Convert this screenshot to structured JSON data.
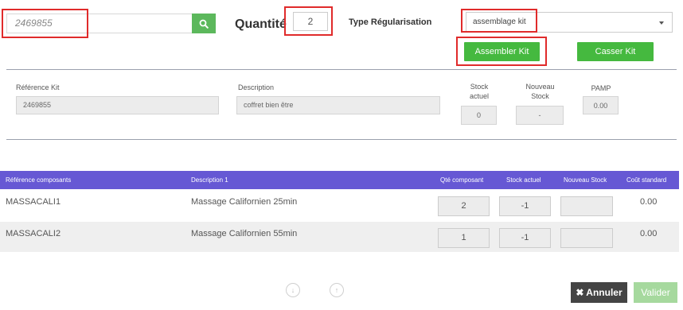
{
  "search": {
    "value": "2469855"
  },
  "quantity": {
    "label": "Quantité",
    "value": "2"
  },
  "regularisation": {
    "label": "Type Régularisation",
    "value": "assemblage kit"
  },
  "buttons": {
    "assembler": "Assembler Kit",
    "casser": "Casser Kit",
    "annuler": "Annuler",
    "valider": "Valider"
  },
  "kit": {
    "ref_label": "Référence Kit",
    "ref_value": "2469855",
    "desc_label": "Description",
    "desc_value": "coffret bien être",
    "stock_actuel_label": [
      "Stock",
      "actuel"
    ],
    "stock_actuel_value": "0",
    "nouveau_stock_label": [
      "Nouveau",
      "Stock"
    ],
    "nouveau_stock_value": "-",
    "pamp_label": "PAMP",
    "pamp_value": "0.00"
  },
  "table": {
    "headers": {
      "ref": "Référence composants",
      "desc": "Description 1",
      "qte": "Qté composant",
      "stock": "Stock actuel",
      "nouveau": "Nouveau Stock",
      "cout": "Coût standard"
    },
    "rows": [
      {
        "ref": "MASSACALI1",
        "desc": "Massage Californien 25min",
        "qte": "2",
        "stock": "-1",
        "nouveau": "",
        "cout": "0.00"
      },
      {
        "ref": "MASSACALI2",
        "desc": "Massage Californien 55min",
        "qte": "1",
        "stock": "-1",
        "nouveau": "",
        "cout": "0.00"
      }
    ]
  },
  "colors": {
    "green": "#45b93f",
    "purple": "#6658d4",
    "highlight": "#e02b2b"
  },
  "icons": [
    "search-icon",
    "chevron-down-icon",
    "arrow-down-icon",
    "arrow-up-icon",
    "close-icon"
  ]
}
